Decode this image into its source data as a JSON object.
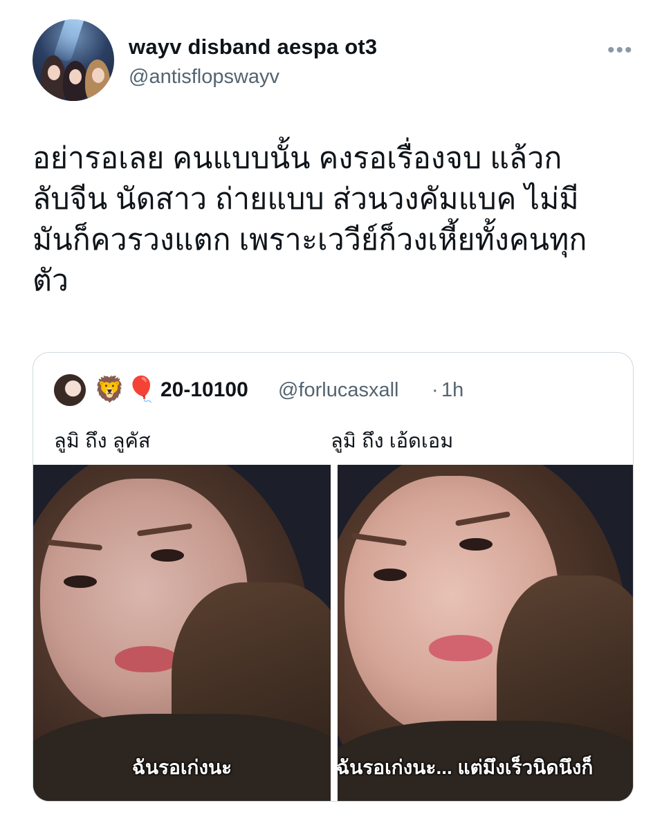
{
  "author": {
    "display_name": "wayv disband aespa ot3",
    "handle": "@antisflopswayv"
  },
  "more_icon": "more-horizontal-icon",
  "tweet": {
    "text": "อย่ารอเลย คนแบบนั้น คงรอเรื่องจบ แล้วก\nลับจีน นัดสาว ถ่ายแบบ ส่วนวงคัมแบค ไม่มี\nมันก็ควรวงแตก เพราะเววีย์ก็วงเหี้ยทั้งคนทุก\nตัว"
  },
  "quoted": {
    "emoji_1": "🦁",
    "emoji_2": "🎈",
    "display_name": "20-10100",
    "handle": "@forlucasxall",
    "separator": "·",
    "time": "1h",
    "label_left": "ลูมิ ถึง ลูคัส",
    "label_right": "ลูมิ ถึง เอ้ดเอม",
    "subtitle_left": "ฉันรอเก่งนะ",
    "subtitle_right": "ฉันรอเก่งนะ... แต่มึงเร็วนิดนึงก็"
  }
}
